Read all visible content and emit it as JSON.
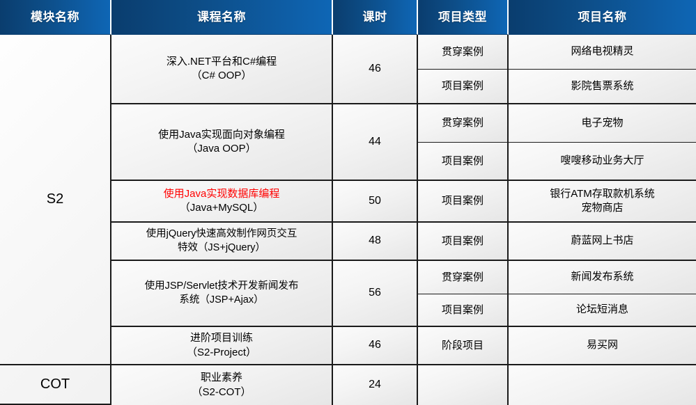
{
  "table": {
    "headers": [
      {
        "label": "模块名称",
        "name": "header-module-name"
      },
      {
        "label": "课程名称",
        "name": "header-course-name"
      },
      {
        "label": "课时",
        "name": "header-hours"
      },
      {
        "label": "项目类型",
        "name": "header-project-type"
      },
      {
        "label": "项目名称",
        "name": "header-project-name"
      }
    ],
    "modules": [
      {
        "label": "S2"
      },
      {
        "label": "COT"
      }
    ],
    "rows": [
      {
        "module": "S2",
        "course_line1": "深入.NET平台和C#编程",
        "course_line2": "（C# OOP）",
        "course_red": false,
        "hours": "46",
        "subrows": [
          {
            "project_type": "贯穿案例",
            "project_name_line1": "网络电视精灵",
            "project_name_line2": ""
          },
          {
            "project_type": "项目案例",
            "project_name_line1": "影院售票系统",
            "project_name_line2": ""
          }
        ]
      },
      {
        "module": "S2",
        "course_line1": "使用Java实现面向对象编程",
        "course_line2": "（Java OOP）",
        "course_red": false,
        "hours": "44",
        "subrows": [
          {
            "project_type": "贯穿案例",
            "project_name_line1": "电子宠物",
            "project_name_line2": ""
          },
          {
            "project_type": "项目案例",
            "project_name_line1": "嗖嗖移动业务大厅",
            "project_name_line2": ""
          }
        ]
      },
      {
        "module": "S2",
        "course_line1": "使用Java实现数据库编程",
        "course_line2": "（Java+MySQL）",
        "course_red": true,
        "hours": "50",
        "subrows": [
          {
            "project_type": "项目案例",
            "project_name_line1": "银行ATM存取款机系统",
            "project_name_line2": "宠物商店"
          }
        ]
      },
      {
        "module": "S2",
        "course_line1": "使用jQuery快速高效制作网页交互",
        "course_line2": "特效（JS+jQuery）",
        "course_red": false,
        "hours": "48",
        "subrows": [
          {
            "project_type": "项目案例",
            "project_name_line1": "蔚蓝网上书店",
            "project_name_line2": ""
          }
        ]
      },
      {
        "module": "S2",
        "course_line1": "使用JSP/Servlet技术开发新闻发布",
        "course_line2": "系统（JSP+Ajax）",
        "course_red": false,
        "hours": "56",
        "subrows": [
          {
            "project_type": "贯穿案例",
            "project_name_line1": "新闻发布系统",
            "project_name_line2": ""
          },
          {
            "project_type": "项目案例",
            "project_name_line1": "论坛短消息",
            "project_name_line2": ""
          }
        ]
      },
      {
        "module": "S2",
        "course_line1": "进阶项目训练",
        "course_line2": "（S2-Project）",
        "course_red": false,
        "hours": "46",
        "subrows": [
          {
            "project_type": "阶段项目",
            "project_name_line1": "易买网",
            "project_name_line2": ""
          }
        ]
      },
      {
        "module": "COT",
        "course_line1": "职业素养",
        "course_line2": "（S2-COT）",
        "course_red": false,
        "hours": "24",
        "subrows": [
          {
            "project_type": "",
            "project_name_line1": "",
            "project_name_line2": ""
          }
        ]
      }
    ]
  },
  "colors": {
    "header_dark": "#0a3d6e",
    "header_light": "#0e66b5",
    "highlight_text": "#ff0000",
    "grid_line": "#1a1a1a"
  }
}
